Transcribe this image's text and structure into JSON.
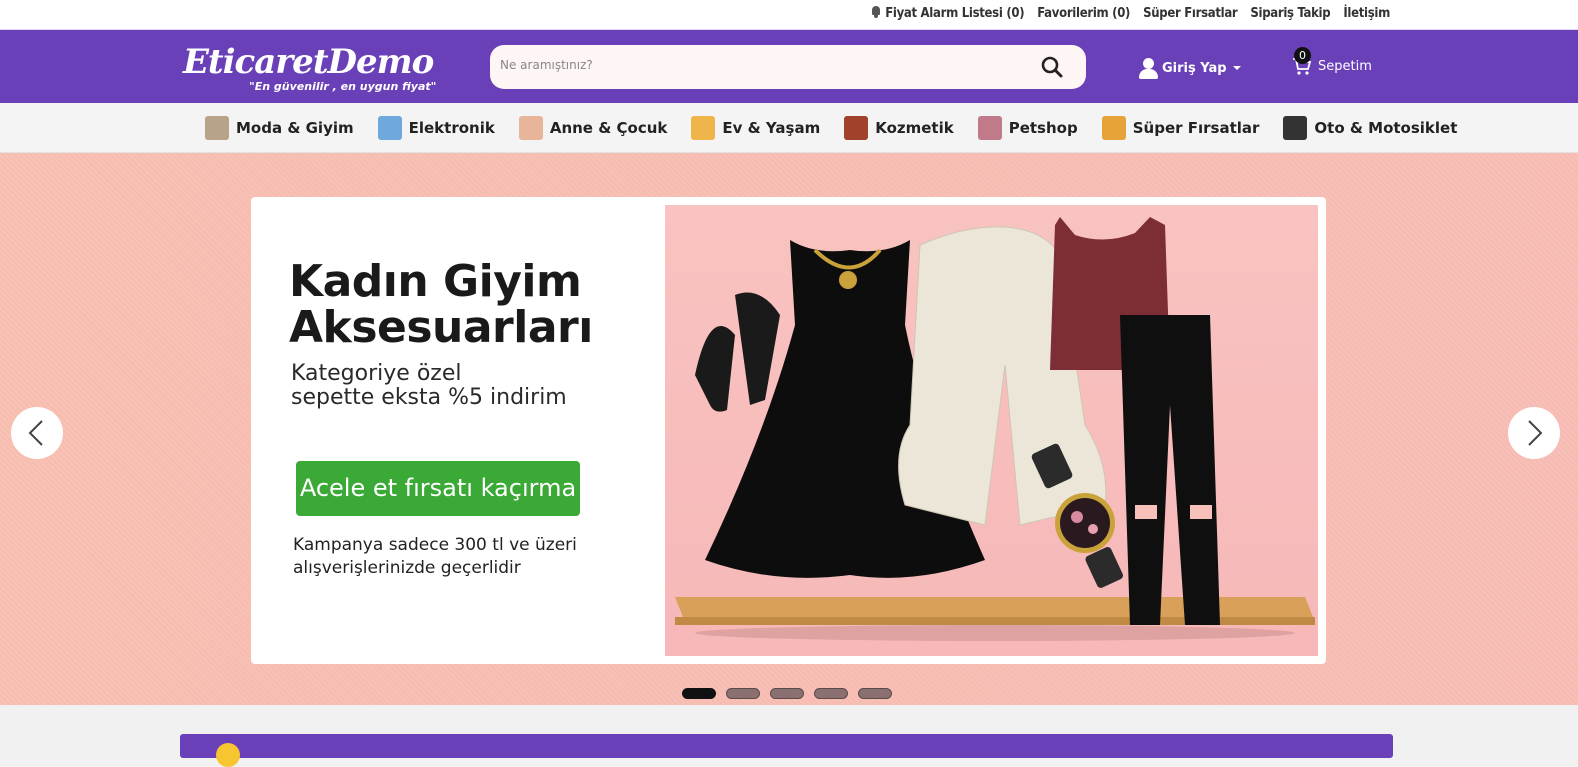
{
  "topbar": {
    "links": [
      {
        "label": "Fiyat Alarm Listesi (0)"
      },
      {
        "label": "Favorilerim (0)"
      },
      {
        "label": "Süper Fırsatlar"
      },
      {
        "label": "Sipariş Takip"
      },
      {
        "label": "İletişim"
      }
    ]
  },
  "header": {
    "logo_name": "EticaretDemo",
    "logo_tagline": "\"En güvenilir , en uygun fiyat\"",
    "search_placeholder": "Ne aramıştınız?",
    "login_label": "Giriş Yap",
    "cart_label": "Sepetim",
    "cart_count": "0",
    "accent": "#6a40b8"
  },
  "categories": [
    {
      "label": "Moda & Giyim",
      "icon": "clothing-icon",
      "color": "#b9a28a"
    },
    {
      "label": "Elektronik",
      "icon": "phone-icon",
      "color": "#6fa8dc"
    },
    {
      "label": "Anne & Çocuk",
      "icon": "baby-icon",
      "color": "#e8b59a"
    },
    {
      "label": "Ev & Yaşam",
      "icon": "lamp-icon",
      "color": "#f0b54a"
    },
    {
      "label": "Kozmetik",
      "icon": "makeup-icon",
      "color": "#a0422a"
    },
    {
      "label": "Petshop",
      "icon": "pet-icon",
      "color": "#c07a8a"
    },
    {
      "label": "Süper Fırsatlar",
      "icon": "deal-badge-icon",
      "color": "#e6a33a"
    },
    {
      "label": "Oto & Motosiklet",
      "icon": "tire-icon",
      "color": "#333333"
    }
  ],
  "hero": {
    "title": "Kadın Giyim Aksesuarları",
    "subtitle_line1": "Kategoriye özel",
    "subtitle_line2": "sepette eksta %5 indirim",
    "cta": "Acele et fırsatı kaçırma",
    "note_line1": "Kampanya sadece 300 tl ve üzeri",
    "note_line2": "alışverişlerinizde geçerlidir",
    "cta_color": "#3aa935",
    "active_slide": 1,
    "slide_count": 5
  }
}
